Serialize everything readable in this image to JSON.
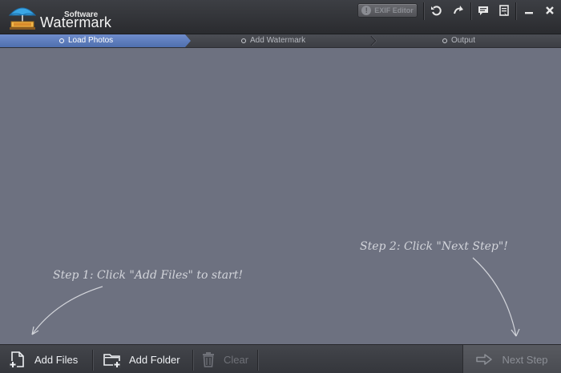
{
  "app": {
    "name_small": "Software",
    "name": "Watermark"
  },
  "titlebar": {
    "exif_label": "EXIF Editor",
    "icons": [
      "undo-icon",
      "redo-icon",
      "feedback-icon",
      "register-icon",
      "minimize-icon",
      "close-icon"
    ]
  },
  "steps": [
    {
      "label": "Load Photos",
      "active": true
    },
    {
      "label": "Add Watermark",
      "active": false
    },
    {
      "label": "Output",
      "active": false
    }
  ],
  "hints": {
    "step1": "Step 1: Click \"Add Files\" to start!",
    "step2": "Step 2: Click \"Next Step\"!"
  },
  "toolbar": {
    "add_files": "Add Files",
    "add_folder": "Add Folder",
    "clear": "Clear",
    "next_step": "Next Step"
  },
  "colors": {
    "canvas": "#6d7180",
    "active_step": "#5a78b8",
    "titlebar": "#333438"
  }
}
